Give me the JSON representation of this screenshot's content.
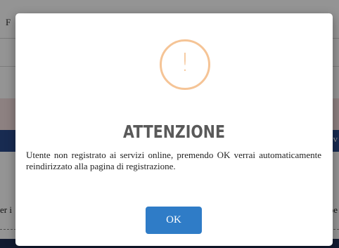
{
  "background": {
    "topbar_letter": "F",
    "blueband_text": "sv",
    "left_text": "er i",
    "right_text": "pe"
  },
  "dialog": {
    "icon": "warning-icon",
    "icon_glyph": "!",
    "title": "ATTENZIONE",
    "message": "Utente non registrato ai servizi online, premendo OK verrai automaticamente reindirizzato alla pagina di registrazione.",
    "ok_label": "OK"
  },
  "colors": {
    "overlay": "rgba(0,0,0,0.42)",
    "icon": "#f5c496",
    "title": "#595959",
    "button": "#2f7cc7",
    "header_band": "#2a4a8c"
  }
}
